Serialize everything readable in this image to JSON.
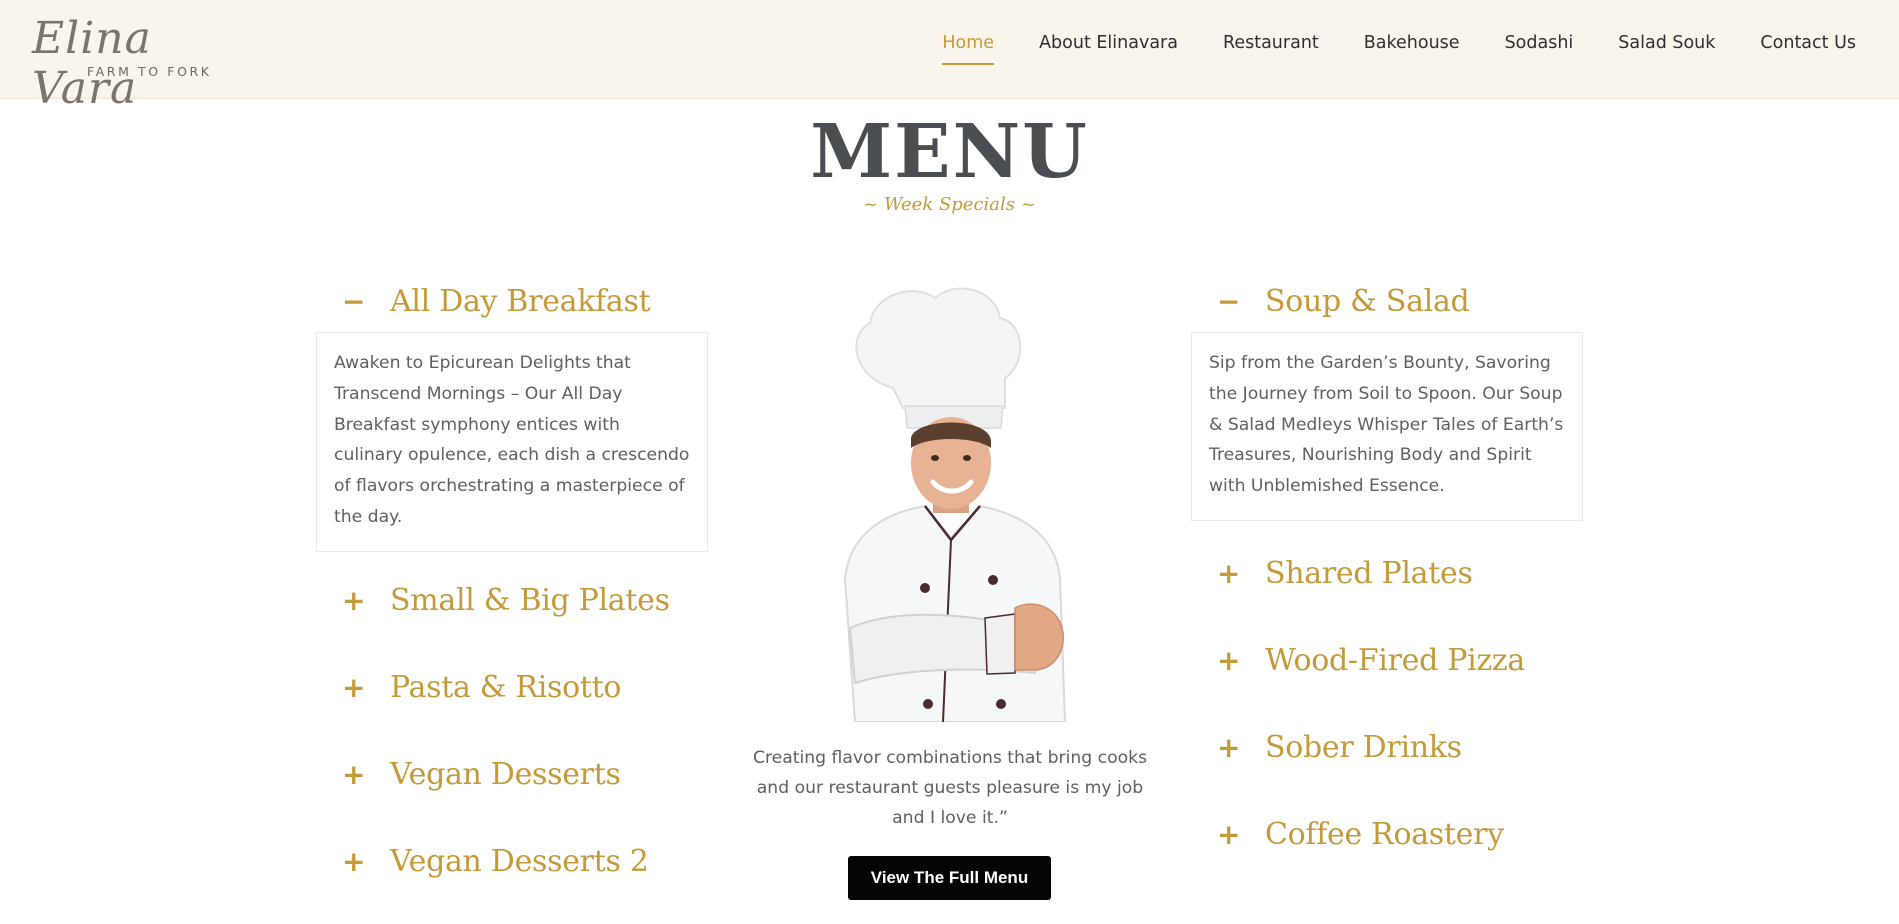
{
  "brand": {
    "name": "Elina Vara",
    "tagline": "FARM TO FORK"
  },
  "nav": [
    {
      "label": "Home",
      "active": true
    },
    {
      "label": "About Elinavara"
    },
    {
      "label": "Restaurant"
    },
    {
      "label": "Bakehouse"
    },
    {
      "label": "Sodashi"
    },
    {
      "label": "Salad Souk"
    },
    {
      "label": "Contact Us"
    }
  ],
  "page": {
    "title": "MENU",
    "subtitle": "~  Week Specials  ~"
  },
  "left_column": [
    {
      "sign": "−",
      "title": "All Day Breakfast",
      "open": true,
      "body": "Awaken to Epicurean Delights that Transcend Mornings – Our All Day Breakfast symphony entices with culinary opulence, each dish a crescendo of flavors orchestrating a masterpiece of the day."
    },
    {
      "sign": "+",
      "title": "Small & Big Plates"
    },
    {
      "sign": "+",
      "title": "Pasta & Risotto"
    },
    {
      "sign": "+",
      "title": "Vegan Desserts"
    },
    {
      "sign": "+",
      "title": "Vegan Desserts 2"
    }
  ],
  "right_column": [
    {
      "sign": "−",
      "title": "Soup & Salad",
      "open": true,
      "body": "Sip from the Garden’s Bounty, Savoring the Journey from Soil to Spoon. Our Soup & Salad Medleys Whisper Tales of Earth’s Treasures, Nourishing Body and Spirit with Unblemished Essence."
    },
    {
      "sign": "+",
      "title": "Shared Plates"
    },
    {
      "sign": "+",
      "title": "Wood-Fired Pizza"
    },
    {
      "sign": "+",
      "title": "Sober Drinks"
    },
    {
      "sign": "+",
      "title": "Coffee Roastery"
    }
  ],
  "quote": "Creating flavor combinations that bring cooks and our restaurant guests pleasure is my job and I love it.”",
  "cta": {
    "label": "View The Full Menu"
  },
  "colors": {
    "accent": "#c49a3a",
    "header_bg": "#faf5ec",
    "title": "#4a4e52",
    "button_bg": "#050505"
  }
}
